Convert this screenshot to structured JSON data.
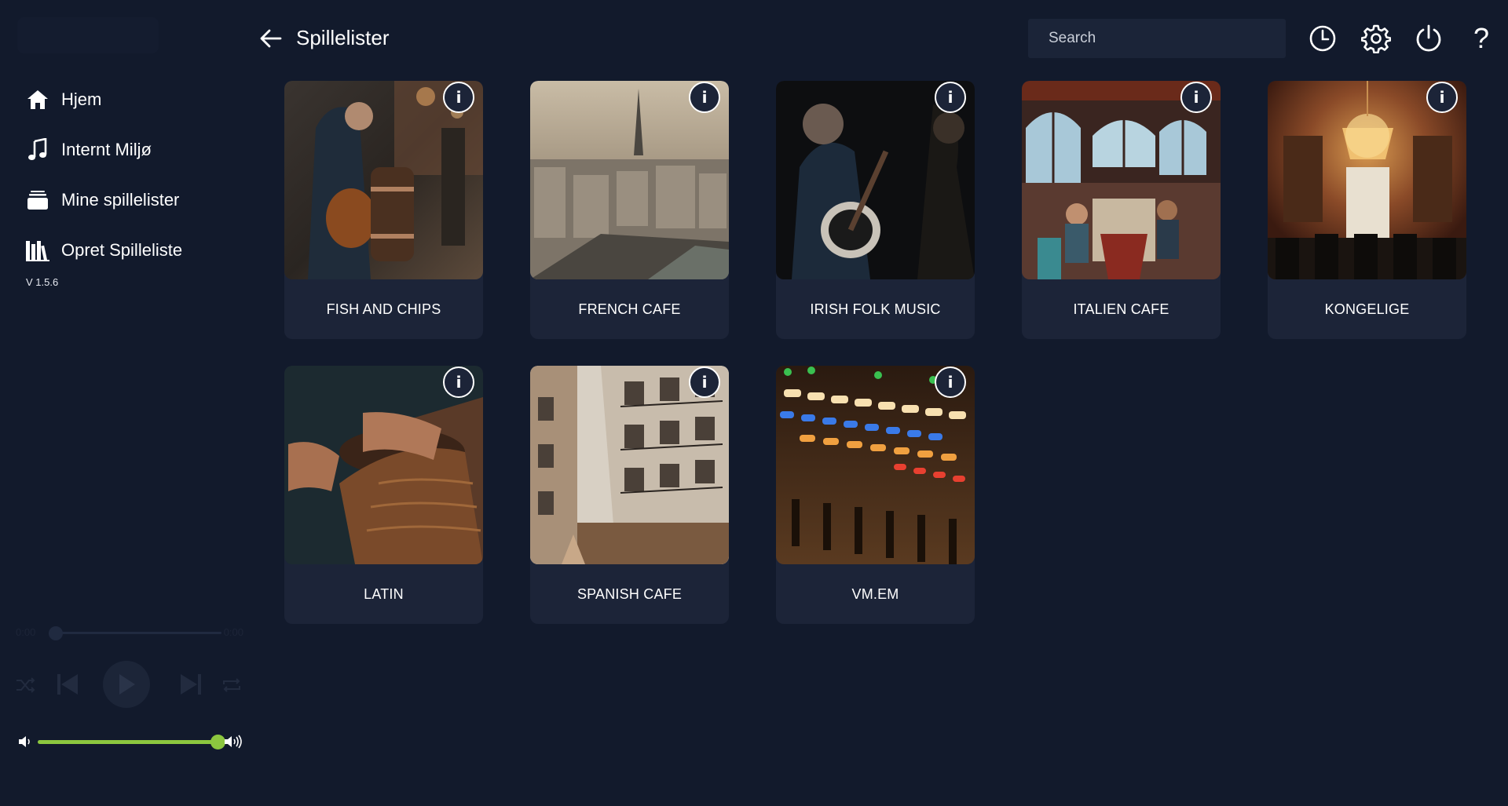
{
  "sidebar": {
    "nav": [
      {
        "label": "Hjem",
        "icon": "home-icon"
      },
      {
        "label": "Internt Miljø",
        "icon": "music-note-icon"
      },
      {
        "label": "Mine spillelister",
        "icon": "stack-icon"
      },
      {
        "label": "Opret Spilleliste",
        "icon": "library-icon"
      }
    ],
    "version": "V 1.5.6"
  },
  "player": {
    "time_current": "0:00",
    "time_total": "0:00",
    "progress": 0,
    "volume": 1.0,
    "accent_color": "#8cc63f"
  },
  "header": {
    "title": "Spillelister",
    "search_placeholder": "Search",
    "icons": [
      "back-arrow-icon",
      "history-icon",
      "settings-icon",
      "power-icon",
      "help-icon"
    ],
    "help_glyph": "?"
  },
  "playlists": [
    {
      "name": "FISH AND CHIPS",
      "info": "i"
    },
    {
      "name": "FRENCH CAFE",
      "info": "i"
    },
    {
      "name": "IRISH FOLK MUSIC",
      "info": "i"
    },
    {
      "name": "ITALIEN CAFE",
      "info": "i"
    },
    {
      "name": "KONGELIGE",
      "info": "i"
    },
    {
      "name": "LATIN",
      "info": "i"
    },
    {
      "name": "SPANISH CAFE",
      "info": "i"
    },
    {
      "name": "VM.EM",
      "info": "i"
    }
  ],
  "colors": {
    "background": "#121a2c",
    "card": "#1c2438",
    "search": "#1b2438",
    "text": "#ffffff"
  }
}
